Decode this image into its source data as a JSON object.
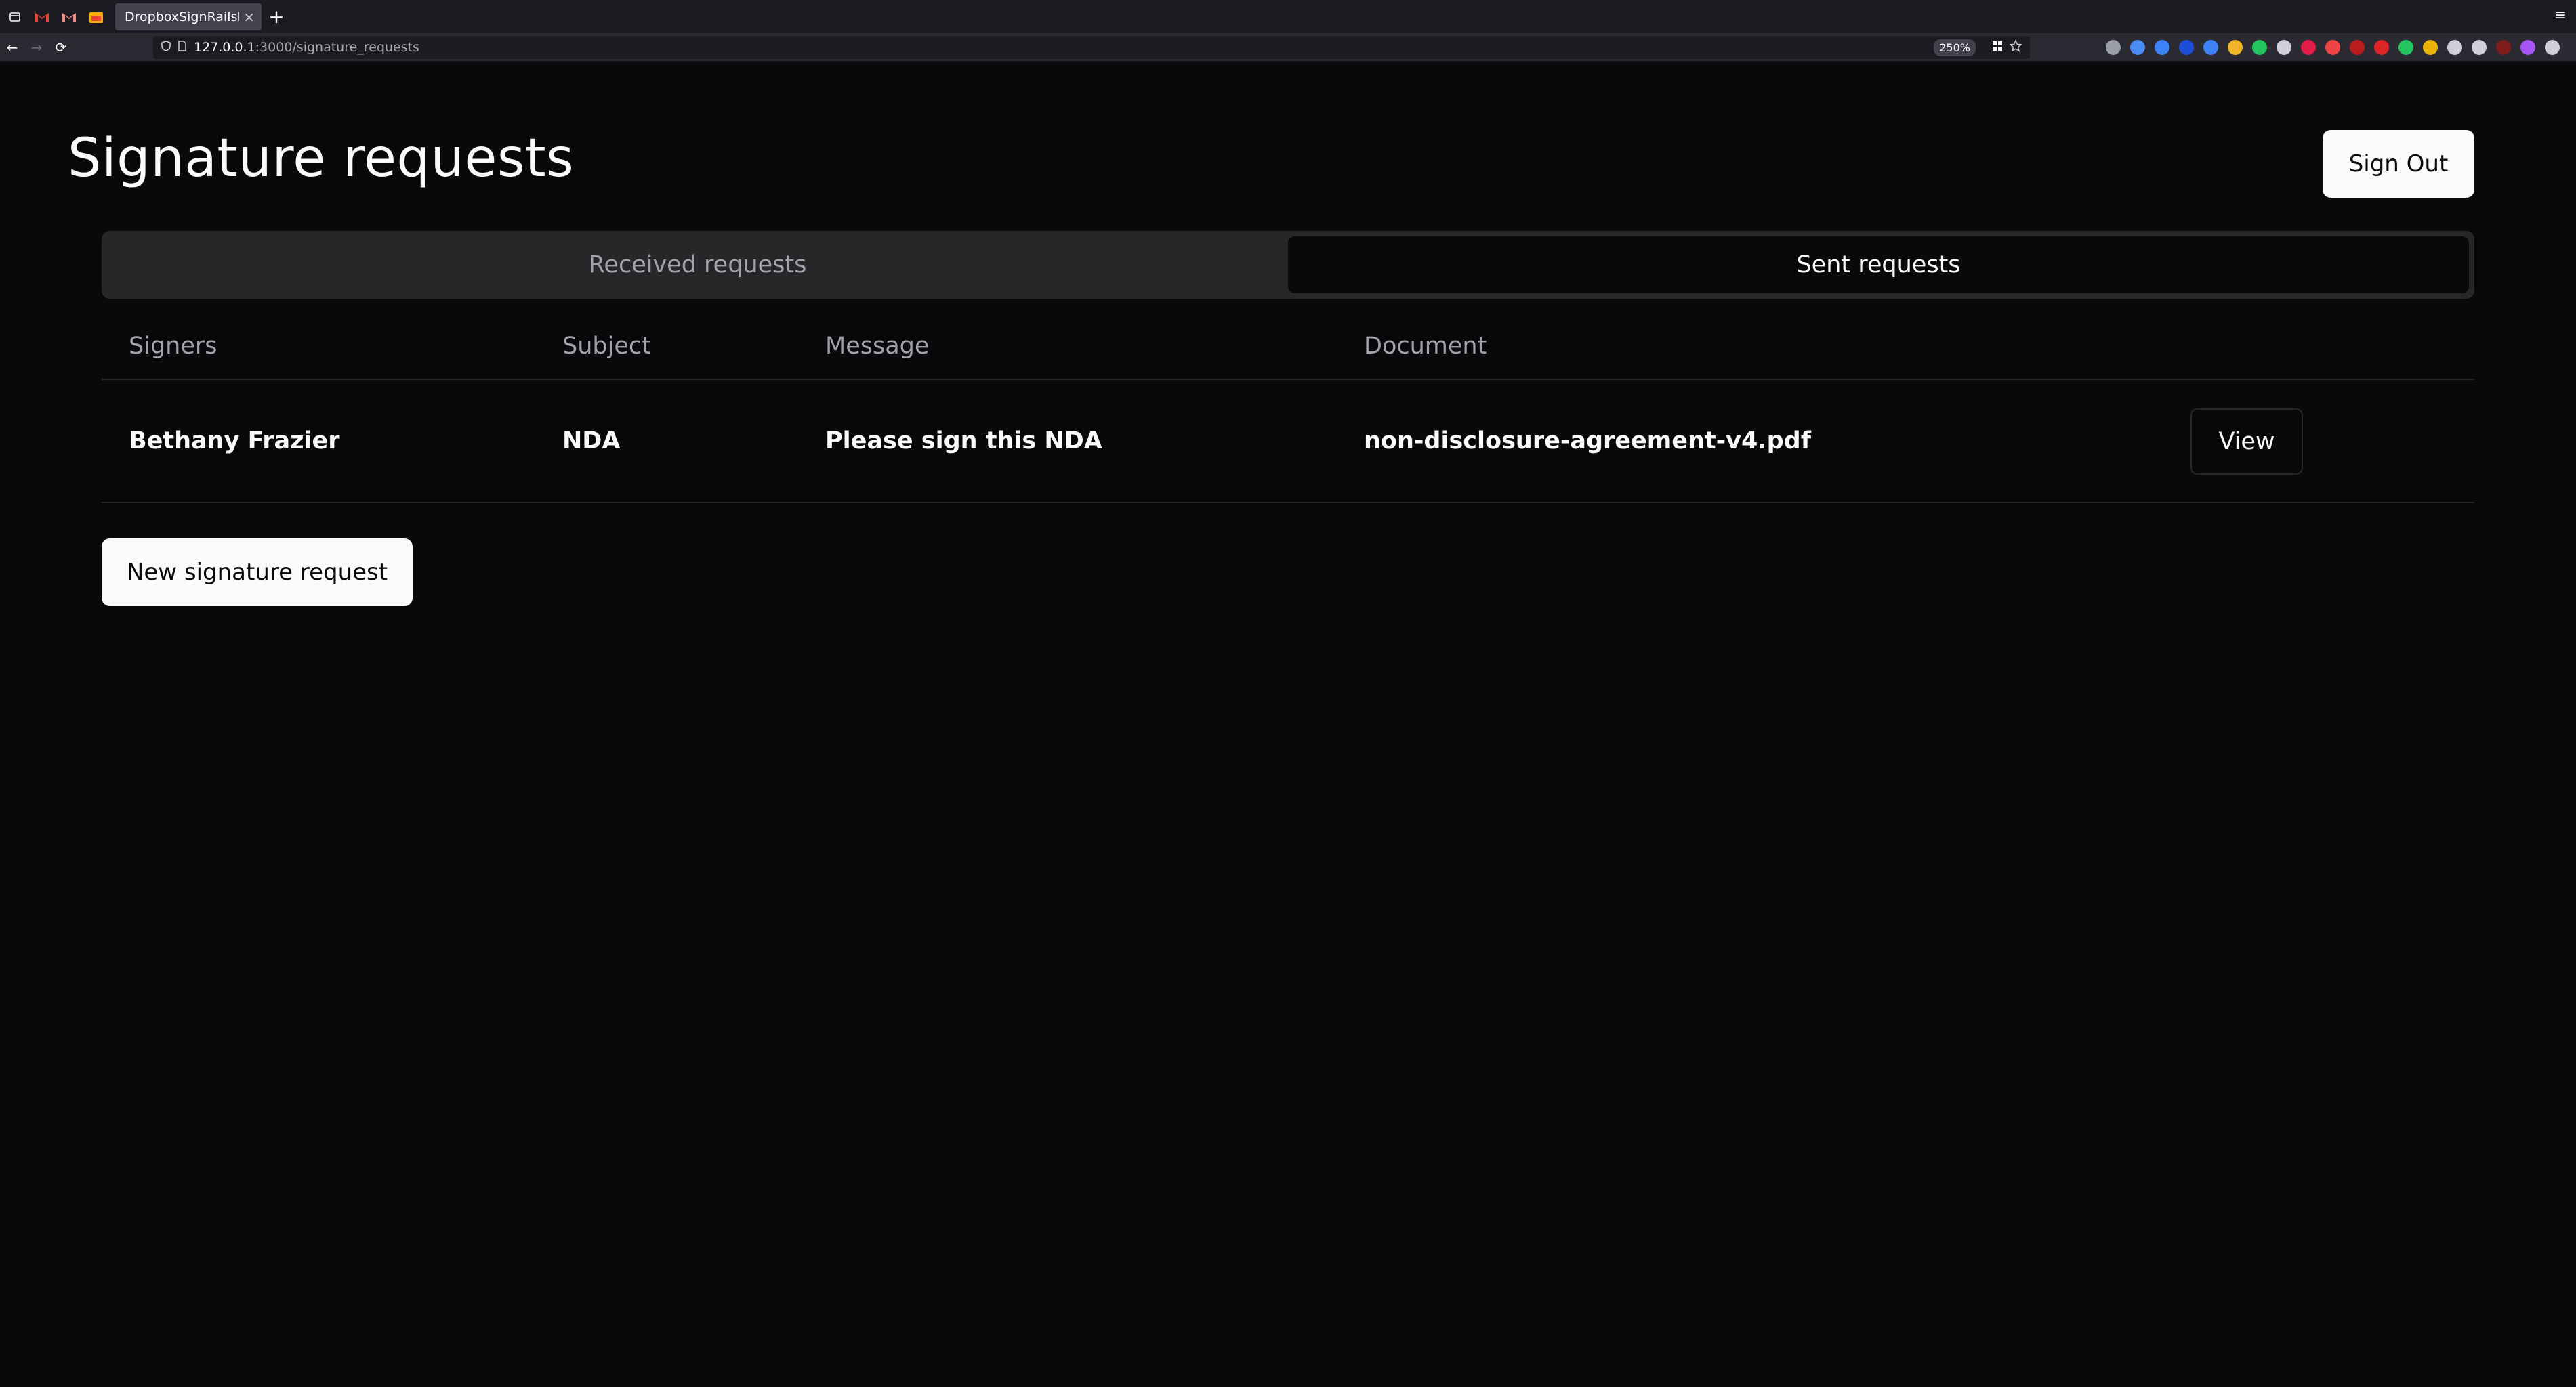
{
  "browser": {
    "tab_title": "DropboxSignRailsD",
    "tab_close": "×",
    "new_tab": "+",
    "overflow": "≡",
    "url_host": "127.0.0.1",
    "url_path": ":3000/signature_requests",
    "zoom": "250%",
    "nav": {
      "back": "←",
      "forward": "→",
      "reload": "⟳"
    },
    "extensions": [
      "#9aa0a6",
      "#4b8bf5",
      "#3b82f6",
      "#1d4ed8",
      "#3c82f6",
      "#f0b429",
      "#22c55e",
      "#cfcfd8",
      "#e11d48",
      "#ef4444",
      "#b91c1c",
      "#dc2626",
      "#22c55e",
      "#eab308",
      "#cfcfd8",
      "#cfcfd8",
      "#7f1d1d",
      "#a855f7",
      "#cfcfd8"
    ]
  },
  "page": {
    "title": "Signature requests",
    "sign_out_label": "Sign Out",
    "tabs": [
      {
        "label": "Received requests",
        "active": false
      },
      {
        "label": "Sent requests",
        "active": true
      }
    ],
    "table": {
      "headers": {
        "signers": "Signers",
        "subject": "Subject",
        "message": "Message",
        "document": "Document"
      },
      "rows": [
        {
          "signers": "Bethany Frazier",
          "subject": "NDA",
          "message": "Please sign this NDA",
          "document": "non-disclosure-agreement-v4.pdf",
          "action_label": "View"
        }
      ]
    },
    "new_request_label": "New signature request"
  },
  "colors": {
    "background": "#09090b",
    "foreground": "#fafafa",
    "muted": "#a1a1aa",
    "border": "#27272a"
  }
}
